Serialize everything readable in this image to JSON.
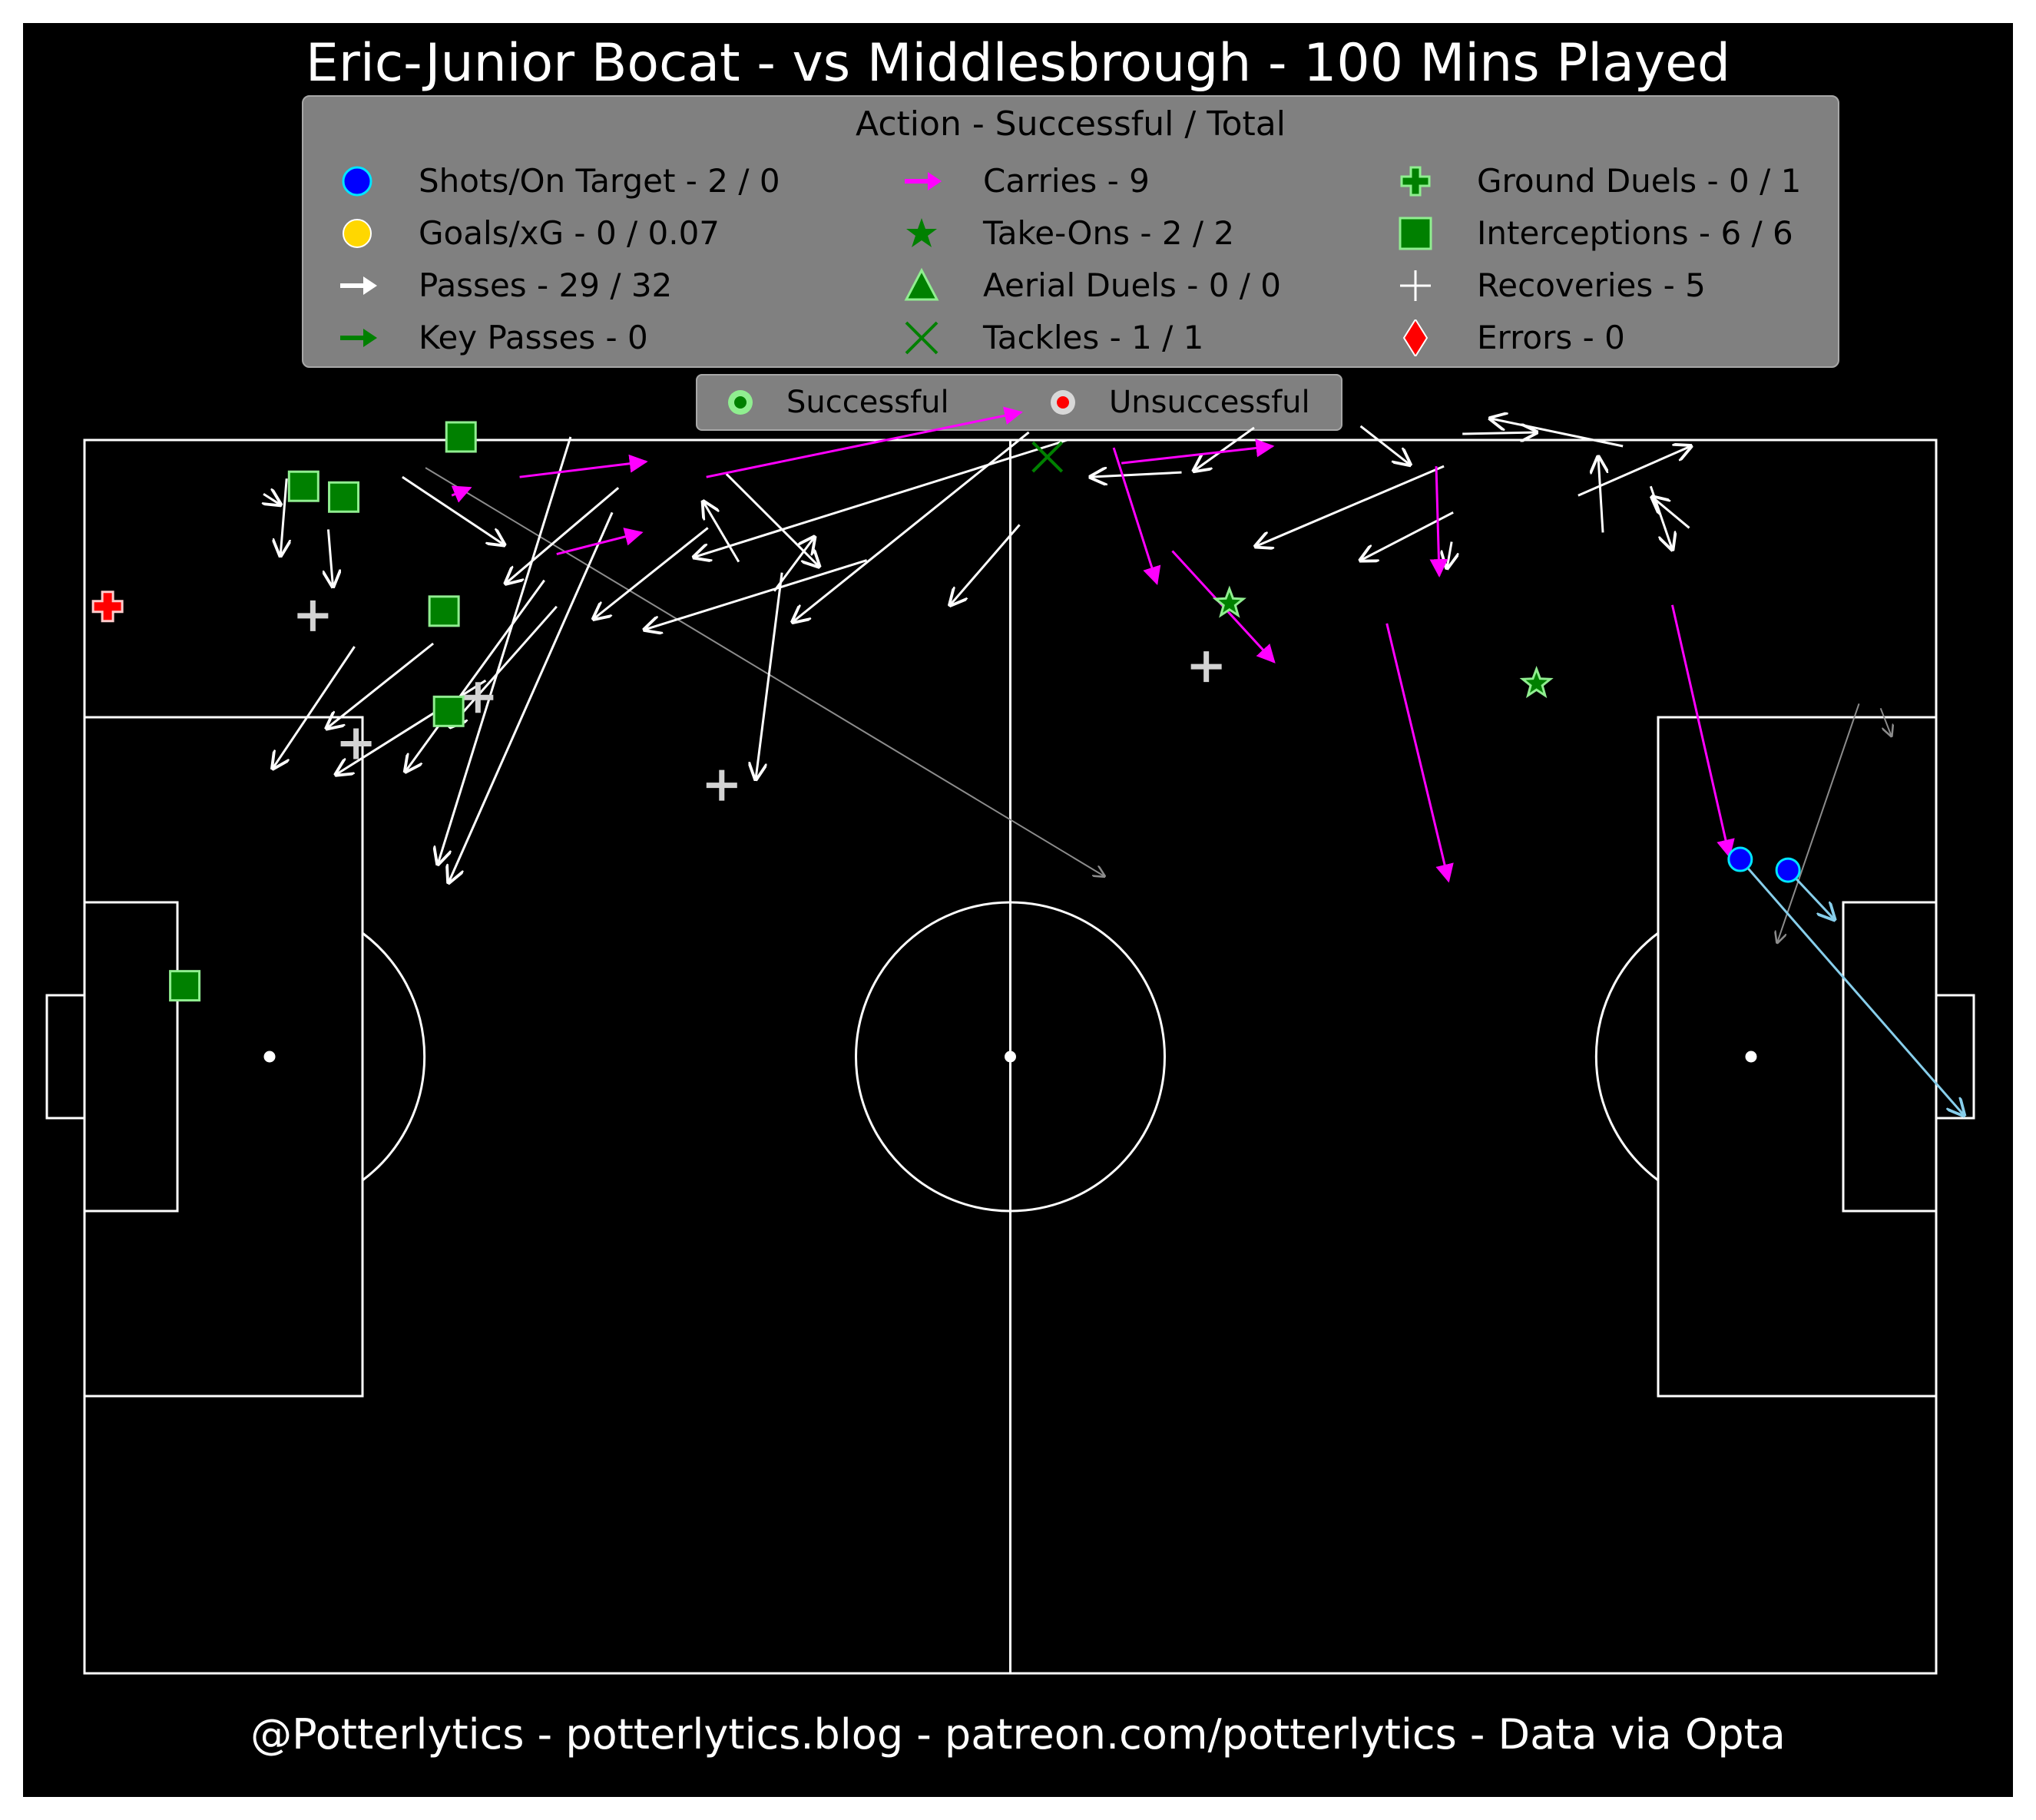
{
  "title": "Eric-Junior Bocat - vs Middlesbrough - 100 Mins Played",
  "footer": "@Potterlytics - potterlytics.blog - patreon.com/potterlytics - Data via Opta",
  "legend": {
    "title": "Action - Successful / Total",
    "items": [
      {
        "label": "Shots/On Target - 2 / 0",
        "icon": "blue-circle-icon",
        "color": "#0000ff"
      },
      {
        "label": "Goals/xG - 0 / 0.07",
        "icon": "gold-circle-icon",
        "color": "#ffd700"
      },
      {
        "label": "Passes - 29 / 32",
        "icon": "white-arrow-icon",
        "color": "#ffffff"
      },
      {
        "label": "Key Passes - 0",
        "icon": "green-arrow-icon",
        "color": "#008000"
      },
      {
        "label": "Carries - 9",
        "icon": "magenta-arrow-icon",
        "color": "#ff00ff"
      },
      {
        "label": "Take-Ons - 2 / 2",
        "icon": "green-star-icon",
        "color": "#008000"
      },
      {
        "label": "Aerial Duels - 0 / 0",
        "icon": "green-triangle-icon",
        "color": "#008000"
      },
      {
        "label": "Tackles - 1 / 1",
        "icon": "green-x-icon",
        "color": "#008000"
      },
      {
        "label": "Ground Duels - 0 / 1",
        "icon": "green-plus-icon",
        "color": "#008000"
      },
      {
        "label": "Interceptions - 6 / 6",
        "icon": "green-square-icon",
        "color": "#008000"
      },
      {
        "label": "Recoveries - 5",
        "icon": "white-cross-icon",
        "color": "#ffffff"
      },
      {
        "label": "Errors - 0",
        "icon": "red-diamond-icon",
        "color": "#ff0000"
      }
    ]
  },
  "outcome_legend": {
    "successful": "Successful",
    "unsuccessful": "Unsuccessful",
    "successful_color": "#90ee90",
    "unsuccessful_color": "#ff0000"
  },
  "chart_data": {
    "type": "scatter",
    "pitch": {
      "length": 120,
      "width": 80,
      "background": "#000000",
      "line_color": "#ffffff"
    },
    "passes_successful": [
      [
        13.1,
        77.5,
        12.7,
        72.5
      ],
      [
        15.8,
        74.2,
        16.1,
        70.5
      ],
      [
        20.6,
        77.6,
        27.2,
        73.2
      ],
      [
        11.6,
        76.5,
        12.7,
        75.8
      ],
      [
        41.6,
        77.8,
        47.6,
        71.8
      ],
      [
        34.6,
        76.9,
        27.3,
        70.7
      ],
      [
        40.4,
        74.3,
        33.0,
        68.4
      ],
      [
        26.0,
        64.4,
        16.3,
        58.3
      ],
      [
        22.6,
        66.8,
        15.7,
        61.3
      ],
      [
        30.6,
        69.2,
        23.7,
        61.4
      ],
      [
        29.8,
        70.9,
        20.8,
        58.5
      ],
      [
        34.2,
        75.3,
        23.6,
        51.3
      ],
      [
        31.5,
        80.2,
        22.9,
        52.5
      ],
      [
        45.2,
        71.4,
        43.5,
        58.0
      ],
      [
        44.7,
        70.2,
        47.3,
        73.7
      ],
      [
        42.4,
        72.1,
        40.1,
        76.0
      ],
      [
        63.7,
        80.0,
        39.5,
        72.4
      ],
      [
        60.6,
        74.5,
        56.1,
        69.3
      ],
      [
        71.1,
        77.9,
        65.2,
        77.6
      ],
      [
        50.7,
        72.2,
        36.3,
        67.7
      ],
      [
        17.5,
        66.6,
        12.2,
        58.7
      ],
      [
        61.2,
        80.5,
        45.9,
        68.2
      ],
      [
        75.8,
        80.8,
        71.9,
        78.0
      ],
      [
        82.7,
        80.9,
        85.9,
        78.4
      ],
      [
        88.1,
        78.3,
        75.9,
        73.1
      ],
      [
        89.3,
        80.4,
        94.1,
        80.5
      ],
      [
        99.7,
        79.6,
        91.1,
        81.4
      ],
      [
        96.8,
        76.4,
        104.1,
        79.6
      ],
      [
        88.6,
        73.4,
        88.3,
        71.7
      ],
      [
        98.4,
        74.0,
        98.1,
        78.9
      ],
      [
        101.5,
        77.0,
        102.9,
        72.9
      ],
      [
        88.7,
        75.3,
        82.7,
        72.2
      ],
      [
        104.0,
        74.3,
        101.6,
        76.3
      ]
    ],
    "passes_unsuccessful": [
      [
        22.1,
        78.2,
        66.1,
        51.7
      ],
      [
        115.0,
        62.9,
        109.7,
        47.4
      ],
      [
        116.4,
        62.6,
        117.1,
        60.8
      ]
    ],
    "carries": [
      [
        23.8,
        76.4,
        25.0,
        76.9
      ],
      [
        28.2,
        77.6,
        36.4,
        78.6
      ],
      [
        30.6,
        72.6,
        36.1,
        74.0
      ],
      [
        40.3,
        77.6,
        60.7,
        81.8
      ],
      [
        67.2,
        78.5,
        77.0,
        79.6
      ],
      [
        66.7,
        79.5,
        69.5,
        70.7
      ],
      [
        70.5,
        72.8,
        77.1,
        65.6
      ],
      [
        87.6,
        78.3,
        87.8,
        71.2
      ],
      [
        84.4,
        68.1,
        88.4,
        51.4
      ],
      [
        102.9,
        69.3,
        106.6,
        53.0
      ]
    ],
    "shots": [
      {
        "x": 107.3,
        "y": 52.8,
        "end_x": 121.8,
        "end_y": 36.2
      },
      {
        "x": 110.4,
        "y": 52.1,
        "end_x": 113.4,
        "end_y": 48.9
      }
    ],
    "interceptions": [
      [
        24.4,
        80.2
      ],
      [
        14.2,
        77.0
      ],
      [
        16.8,
        76.3
      ],
      [
        23.3,
        68.9
      ],
      [
        23.6,
        62.4
      ],
      [
        6.5,
        44.6
      ]
    ],
    "recoveries": [
      [
        14.8,
        68.6
      ],
      [
        25.5,
        63.3
      ],
      [
        17.6,
        60.3
      ],
      [
        41.3,
        57.6
      ],
      [
        72.7,
        65.3
      ]
    ],
    "take_ons": [
      [
        74.2,
        69.4
      ],
      [
        94.1,
        64.2
      ]
    ],
    "tackles": [
      [
        62.4,
        78.9
      ]
    ],
    "ground_duels_unsuccessful": [
      [
        1.5,
        69.2
      ]
    ]
  }
}
